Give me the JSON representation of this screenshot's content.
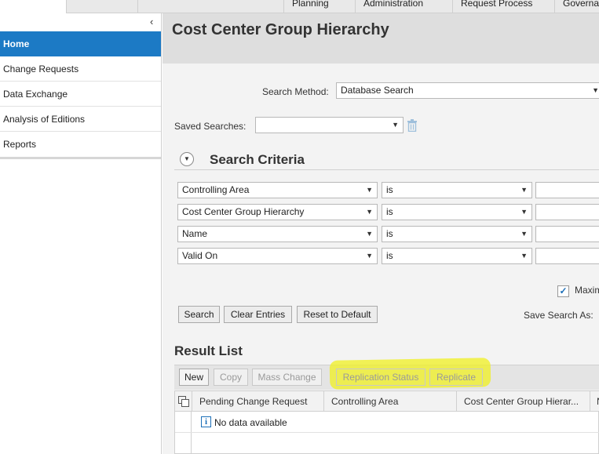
{
  "top_nav": {
    "tabs": [
      "Planning",
      "Administration",
      "Request Process",
      "Governance"
    ]
  },
  "sidebar": {
    "collapse_glyph": "‹",
    "items": [
      {
        "label": "Home",
        "active": true
      },
      {
        "label": "Change Requests",
        "active": false
      },
      {
        "label": "Data Exchange",
        "active": false
      },
      {
        "label": "Analysis of Editions",
        "active": false
      },
      {
        "label": "Reports",
        "active": false
      }
    ]
  },
  "main": {
    "title": "Cost Center Group Hierarchy",
    "search_method": {
      "label": "Search Method:",
      "value": "Database Search"
    },
    "saved_searches": {
      "label": "Saved Searches:",
      "value": ""
    },
    "search_criteria": {
      "title": "Search Criteria",
      "rows": [
        {
          "field": "Controlling Area",
          "operator": "is",
          "value": ""
        },
        {
          "field": "Cost Center Group Hierarchy",
          "operator": "is",
          "value": ""
        },
        {
          "field": "Name",
          "operator": "is",
          "value": ""
        },
        {
          "field": "Valid On",
          "operator": "is",
          "value": ""
        }
      ]
    },
    "max_hits_label": "Maxim",
    "max_hits_checked": true,
    "buttons": {
      "search": "Search",
      "clear": "Clear Entries",
      "reset": "Reset to Default"
    },
    "save_search_as_label": "Save Search As:",
    "result_list": {
      "title": "Result List",
      "toolbar": [
        "New",
        "Copy",
        "Mass Change",
        "Replication Status",
        "Replicate"
      ],
      "columns": [
        "Pending Change Request",
        "Controlling Area",
        "Cost Center Group Hierar...",
        "N"
      ],
      "empty_text": "No data available"
    }
  },
  "colors": {
    "accent": "#1c7ac5",
    "highlight": "#f0f028"
  },
  "icons": {
    "sidebar_collapse": "chevron-left-icon",
    "dropdown": "chevron-down-icon",
    "delete": "trash-icon",
    "section_toggle": "collapse-circle-icon",
    "checkbox": "checkmark-icon",
    "table_select": "select-all-icon",
    "info": "info-icon"
  }
}
